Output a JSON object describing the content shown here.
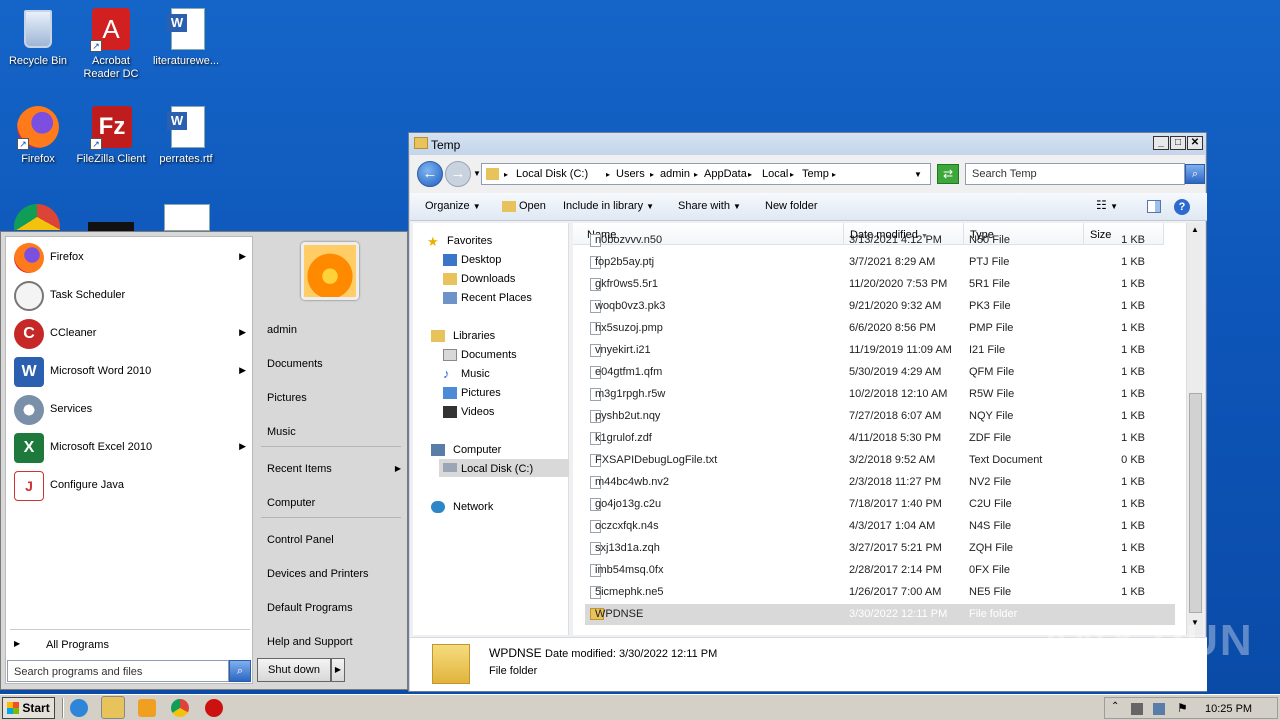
{
  "desktop": {
    "icons": [
      {
        "label": "Recycle Bin"
      },
      {
        "label": "Acrobat Reader DC"
      },
      {
        "label": "literaturewe..."
      },
      {
        "label": "Firefox"
      },
      {
        "label": "FileZilla Client"
      },
      {
        "label": "perrates.rtf"
      }
    ],
    "watermark": "ANY RUN"
  },
  "explorer": {
    "title": "Temp",
    "breadcrumb": [
      "Local Disk (C:)",
      "Users",
      "admin",
      "AppData",
      "Local",
      "Temp"
    ],
    "search_placeholder": "Search Temp",
    "toolbar": {
      "organize": "Organize",
      "open": "Open",
      "include": "Include in library",
      "share": "Share with",
      "new_folder": "New folder"
    },
    "nav": {
      "favorites": "Favorites",
      "desktop": "Desktop",
      "downloads": "Downloads",
      "recent": "Recent Places",
      "libraries": "Libraries",
      "documents": "Documents",
      "music": "Music",
      "pictures": "Pictures",
      "videos": "Videos",
      "computer": "Computer",
      "local_disk": "Local Disk (C:)",
      "network": "Network"
    },
    "columns": {
      "name": "Name",
      "date": "Date modified",
      "type": "Type",
      "size": "Size"
    },
    "files": [
      {
        "name": "n0bozvvv.n50",
        "date": "3/13/2021 4:12 PM",
        "type": "N50 File",
        "size": "1 KB"
      },
      {
        "name": "fop2b5ay.ptj",
        "date": "3/7/2021 8:29 AM",
        "type": "PTJ File",
        "size": "1 KB"
      },
      {
        "name": "gkfr0ws5.5r1",
        "date": "11/20/2020 7:53 PM",
        "type": "5R1 File",
        "size": "1 KB"
      },
      {
        "name": "woqb0vz3.pk3",
        "date": "9/21/2020 9:32 AM",
        "type": "PK3 File",
        "size": "1 KB"
      },
      {
        "name": "hx5suzoj.pmp",
        "date": "6/6/2020 8:56 PM",
        "type": "PMP File",
        "size": "1 KB"
      },
      {
        "name": "vnyekirt.i21",
        "date": "11/19/2019 11:09 AM",
        "type": "I21 File",
        "size": "1 KB"
      },
      {
        "name": "e04gtfm1.qfm",
        "date": "5/30/2019 4:29 AM",
        "type": "QFM File",
        "size": "1 KB"
      },
      {
        "name": "m3g1rpgh.r5w",
        "date": "10/2/2018 12:10 AM",
        "type": "R5W File",
        "size": "1 KB"
      },
      {
        "name": "pyshb2ut.nqy",
        "date": "7/27/2018 6:07 AM",
        "type": "NQY File",
        "size": "1 KB"
      },
      {
        "name": "k1grulof.zdf",
        "date": "4/11/2018 5:30 PM",
        "type": "ZDF File",
        "size": "1 KB"
      },
      {
        "name": "FXSAPIDebugLogFile.txt",
        "date": "3/2/2018 9:52 AM",
        "type": "Text Document",
        "size": "0 KB"
      },
      {
        "name": "m44bc4wb.nv2",
        "date": "2/3/2018 11:27 PM",
        "type": "NV2 File",
        "size": "1 KB"
      },
      {
        "name": "go4jo13g.c2u",
        "date": "7/18/2017 1:40 PM",
        "type": "C2U File",
        "size": "1 KB"
      },
      {
        "name": "oczcxfqk.n4s",
        "date": "4/3/2017 1:04 AM",
        "type": "N4S File",
        "size": "1 KB"
      },
      {
        "name": "sxj13d1a.zqh",
        "date": "3/27/2017 5:21 PM",
        "type": "ZQH File",
        "size": "1 KB"
      },
      {
        "name": "imb54msq.0fx",
        "date": "2/28/2017 2:14 PM",
        "type": "0FX File",
        "size": "1 KB"
      },
      {
        "name": "5icmephk.ne5",
        "date": "1/26/2017 7:00 AM",
        "type": "NE5 File",
        "size": "1 KB"
      },
      {
        "name": "WPDNSE",
        "date": "3/30/2022 12:11 PM",
        "type": "File folder",
        "size": ""
      }
    ],
    "details": {
      "name": "WPDNSE",
      "date_label": "Date modified: 3/30/2022 12:11 PM",
      "type": "File folder"
    }
  },
  "start_menu": {
    "programs": [
      {
        "label": "Firefox"
      },
      {
        "label": "Task Scheduler"
      },
      {
        "label": "CCleaner"
      },
      {
        "label": "Microsoft Word 2010"
      },
      {
        "label": "Services"
      },
      {
        "label": "Microsoft Excel 2010"
      },
      {
        "label": "Configure Java"
      }
    ],
    "all_programs": "All Programs",
    "search_placeholder": "Search programs and files",
    "right": {
      "admin": "admin",
      "documents": "Documents",
      "pictures": "Pictures",
      "music": "Music",
      "recent": "Recent Items",
      "computer": "Computer",
      "control_panel": "Control Panel",
      "devices": "Devices and Printers",
      "default_programs": "Default Programs",
      "help": "Help and Support"
    },
    "shutdown": "Shut down"
  },
  "taskbar": {
    "start": "Start",
    "clock": "10:25 PM"
  }
}
